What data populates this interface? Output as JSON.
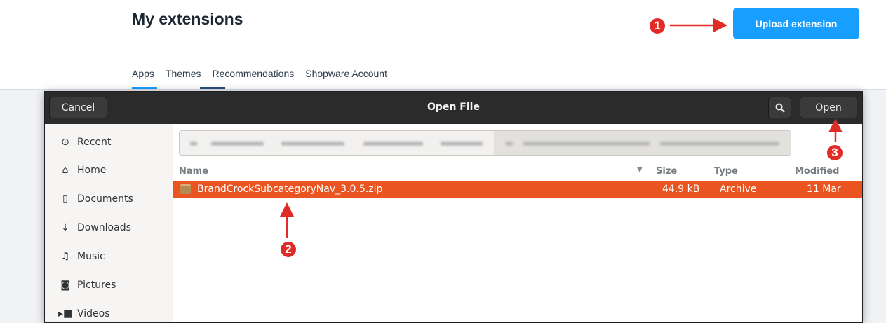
{
  "page": {
    "title": "My extensions",
    "upload_label": "Upload extension",
    "tabs": [
      "Apps",
      "Themes",
      "Recommendations",
      "Shopware Account"
    ]
  },
  "annotations": [
    "1",
    "2",
    "3"
  ],
  "dialog": {
    "title": "Open File",
    "cancel_label": "Cancel",
    "open_label": "Open",
    "search_icon": "search-icon",
    "sidebar": [
      {
        "label": "Recent",
        "icon": "clock-icon"
      },
      {
        "label": "Home",
        "icon": "home-icon"
      },
      {
        "label": "Documents",
        "icon": "document-icon"
      },
      {
        "label": "Downloads",
        "icon": "download-icon"
      },
      {
        "label": "Music",
        "icon": "music-icon"
      },
      {
        "label": "Pictures",
        "icon": "camera-icon"
      },
      {
        "label": "Videos",
        "icon": "video-icon"
      }
    ],
    "columns": {
      "name": "Name",
      "size": "Size",
      "type": "Type",
      "modified": "Modified"
    },
    "files": [
      {
        "name": "BrandCrockSubcategoryNav_3.0.5.zip",
        "size": "44.9 kB",
        "type": "Archive",
        "modified": "11 Mar"
      }
    ],
    "selection_color": "#e95420"
  },
  "colors": {
    "accent": "#189eff",
    "marker": "#e02b27"
  }
}
